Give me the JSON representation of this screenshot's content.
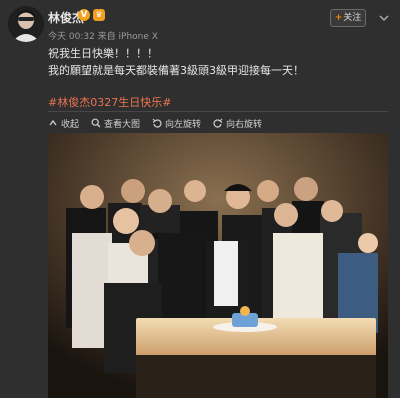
{
  "post": {
    "username": "林俊杰",
    "verified_badge": "V",
    "meta": "今天 00:32 来自 iPhone X",
    "follow_label": "关注",
    "follow_plus": "+",
    "text_line1": "祝我生日快樂！！！！",
    "text_line2": "我的願望就是每天都裝備著3級頭3級甲迎接每一天！",
    "hashtag": "#林俊杰0327生日快乐#"
  },
  "toolbar": {
    "items": [
      {
        "label": "收起",
        "icon": "collapse-icon"
      },
      {
        "label": "查看大图",
        "icon": "zoom-icon"
      },
      {
        "label": "向左旋转",
        "icon": "rotate-left-icon"
      },
      {
        "label": "向右旋转",
        "icon": "rotate-right-icon"
      }
    ]
  },
  "colors": {
    "background": "#2f2f2f",
    "hashtag": "#eb7350",
    "verified": "#f3a21b",
    "follow_plus": "#ff8200"
  }
}
